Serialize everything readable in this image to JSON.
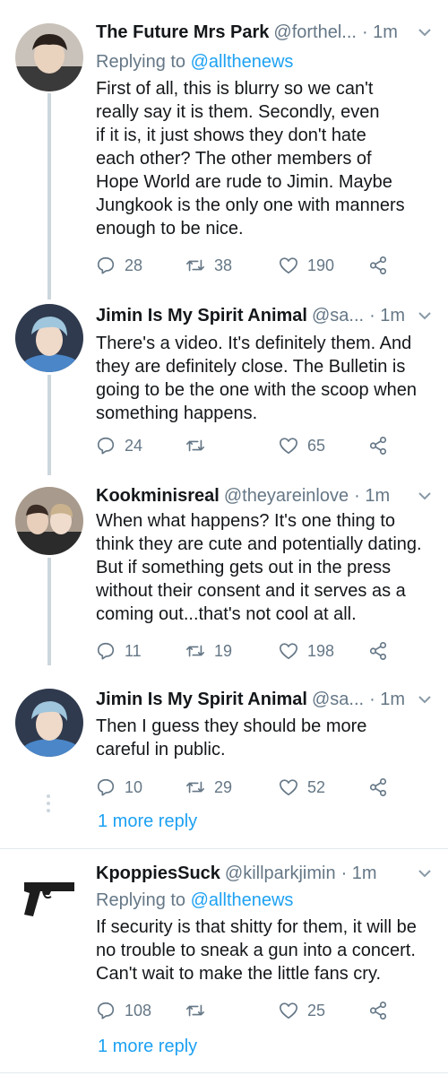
{
  "tweets": [
    {
      "name": "The Future Mrs Park",
      "handle": "@forthel...",
      "time": "· 1m",
      "replying_prefix": "Replying to ",
      "replying_to": "@allthenews",
      "lines": [
        "First of all, this is blurry so we can't",
        "really say it is them. Secondly, even",
        "if it is, it just shows they don't hate",
        "each other? The other members of",
        "Hope World are rude to Jimin. Maybe",
        "Jungkook is the only one with manners",
        "enough to be nice."
      ],
      "replies": "28",
      "retweets": "38",
      "likes": "190"
    },
    {
      "name": "Jimin Is My Spirit Animal",
      "handle": "@sa...",
      "time": "· 1m",
      "lines": [
        "There's a video. It's definitely them. And",
        "they are definitely close. The Bulletin is",
        "going to be the one with the scoop when",
        "something happens."
      ],
      "replies": "24",
      "retweets": "",
      "likes": "65"
    },
    {
      "name": "Kookminisreal",
      "handle": "@theyareinlove",
      "time": "· 1m",
      "lines": [
        "When what happens? It's one thing to",
        "think they are cute and potentially dating.",
        "But if something gets out in the press",
        "without their consent and it serves as a",
        "coming out...that's not cool at all."
      ],
      "replies": "11",
      "retweets": "19",
      "likes": "198"
    },
    {
      "name": "Jimin Is My Spirit Animal",
      "handle": "@sa...",
      "time": "· 1m",
      "lines": [
        "Then I guess they should be more",
        "careful in public."
      ],
      "replies": "10",
      "retweets": "29",
      "likes": "52"
    },
    {
      "name": "KpoppiesSuck",
      "handle": "@killparkjimin",
      "time": "· 1m",
      "replying_prefix": "Replying to ",
      "replying_to": "@allthenews",
      "lines": [
        "If security is that shitty for them, it will be",
        "no trouble to sneak a gun into a concert.",
        "Can't wait to make the little fans cry."
      ],
      "replies": "108",
      "retweets": "",
      "likes": "25"
    }
  ],
  "more_replies": [
    "1 more reply",
    "1 more reply"
  ],
  "icons": [
    "avatar",
    "chevron-down-icon",
    "reply-icon",
    "retweet-icon",
    "like-icon",
    "share-icon",
    "gun-icon"
  ],
  "colors": {
    "link": "#1da1f2",
    "muted": "#657786",
    "text": "#14171a",
    "thread_line": "#ccd6dd"
  }
}
